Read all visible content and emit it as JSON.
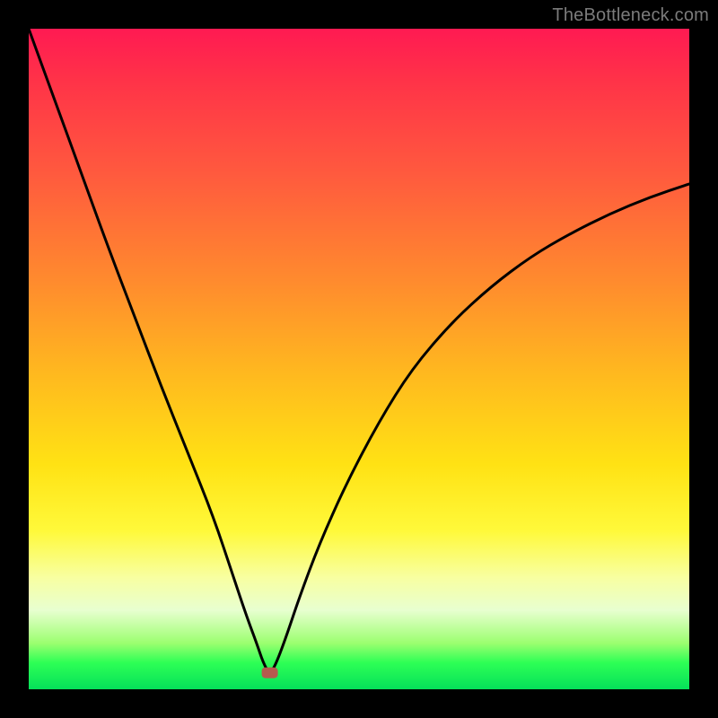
{
  "watermark": "TheBottleneck.com",
  "chart_data": {
    "type": "line",
    "title": "",
    "xlabel": "",
    "ylabel": "",
    "xlim": [
      0,
      100
    ],
    "ylim": [
      0,
      100
    ],
    "grid": false,
    "legend": false,
    "annotations": [
      {
        "kind": "marker",
        "shape": "rounded-rect",
        "x": 36.5,
        "y": 2.5,
        "color": "#b65a4e"
      }
    ],
    "series": [
      {
        "name": "curve",
        "color": "#000000",
        "x": [
          0,
          4,
          8,
          12,
          16,
          20,
          24,
          28,
          31,
          33,
          34.5,
          35.5,
          36.5,
          37.5,
          39,
          41,
          44,
          48,
          53,
          58,
          64,
          70,
          76,
          82,
          88,
          94,
          100
        ],
        "y": [
          100,
          89,
          78,
          67,
          56.5,
          46,
          36,
          26,
          17,
          11,
          7,
          4,
          2.2,
          4,
          8,
          14,
          22,
          31,
          40.5,
          48.5,
          55.5,
          61,
          65.5,
          69,
          72,
          74.5,
          76.5
        ]
      }
    ],
    "background_gradient": {
      "direction": "top-to-bottom",
      "stops": [
        {
          "pos": 0.0,
          "color": "#ff1a52"
        },
        {
          "pos": 0.38,
          "color": "#ff8a2e"
        },
        {
          "pos": 0.66,
          "color": "#ffe214"
        },
        {
          "pos": 0.88,
          "color": "#e8ffd0"
        },
        {
          "pos": 1.0,
          "color": "#05e05a"
        }
      ]
    }
  }
}
